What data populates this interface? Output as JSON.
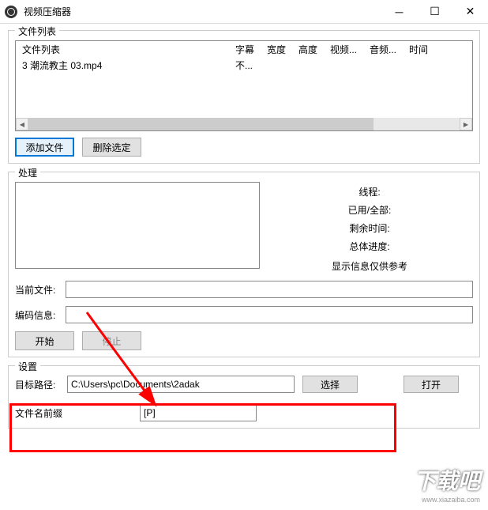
{
  "titlebar": {
    "title": "视频压缩器"
  },
  "fileList": {
    "groupLabel": "文件列表",
    "headers": {
      "file": "文件列表",
      "subtitle": "字幕",
      "width": "宽度",
      "height": "高度",
      "video": "视频...",
      "audio": "音频...",
      "time": "时间"
    },
    "rows": [
      {
        "file": "3 潮流教主 03.mp4",
        "subtitle": "不..."
      }
    ],
    "addButton": "添加文件",
    "deleteButton": "删除选定"
  },
  "processing": {
    "groupLabel": "处理",
    "stats": {
      "threads": "线程:",
      "used": "已用/全部:",
      "remaining": "剩余时间:",
      "overall": "总体进度:"
    },
    "note": "显示信息仅供参考",
    "currentFileLabel": "当前文件:",
    "currentFileValue": "",
    "encodingLabel": "编码信息:",
    "encodingValue": "",
    "startButton": "开始",
    "stopButton": "停止"
  },
  "settings": {
    "groupLabel": "设置",
    "targetPathLabel": "目标路径:",
    "targetPathValue": "C:\\Users\\pc\\Documents\\2adak",
    "chooseButton": "选择",
    "openButton": "打开",
    "prefixLabel": "文件名前缀",
    "prefixValue": "[P]"
  },
  "watermark": {
    "logo": "下载吧",
    "url": "www.xiazaiba.com"
  }
}
